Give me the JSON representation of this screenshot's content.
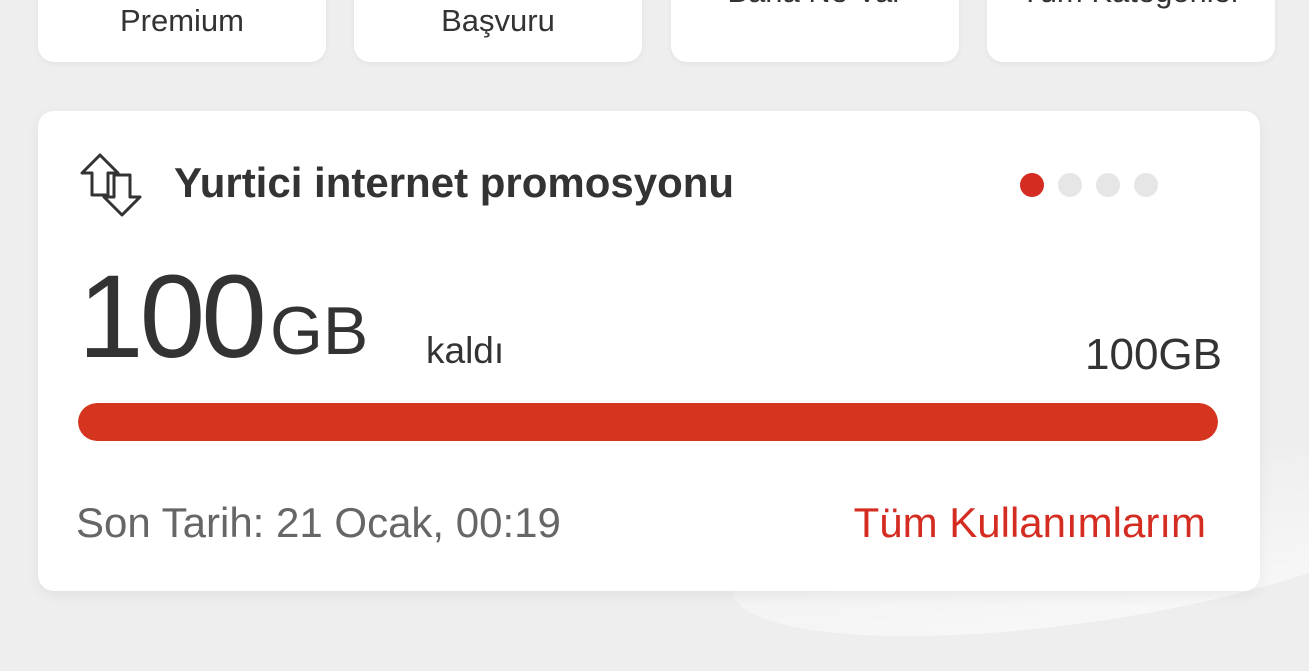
{
  "top_tiles": [
    {
      "label": "Premium"
    },
    {
      "label": "Başvuru"
    },
    {
      "label": "Bana Ne Var"
    },
    {
      "label": "Tüm Kategoriler"
    }
  ],
  "card": {
    "icon": "data-transfer-arrows-icon",
    "title": "Yurtici internet promosyonu",
    "carousel": {
      "count": 4,
      "active_index": 0
    },
    "remaining_amount": "100",
    "remaining_unit": "GB",
    "remaining_label": "kaldı",
    "total": "100GB",
    "progress_fraction": 1.0,
    "deadline": "Son Tarih: 21 Ocak, 00:19",
    "all_usage_link": "Tüm Kullanımlarım"
  },
  "colors": {
    "accent": "#d42c21",
    "progress": "#d5351f",
    "background": "#efeeee",
    "card": "#ffffff",
    "text": "#333333",
    "muted_text": "#666666",
    "inactive_dot": "#e6e6e6"
  }
}
